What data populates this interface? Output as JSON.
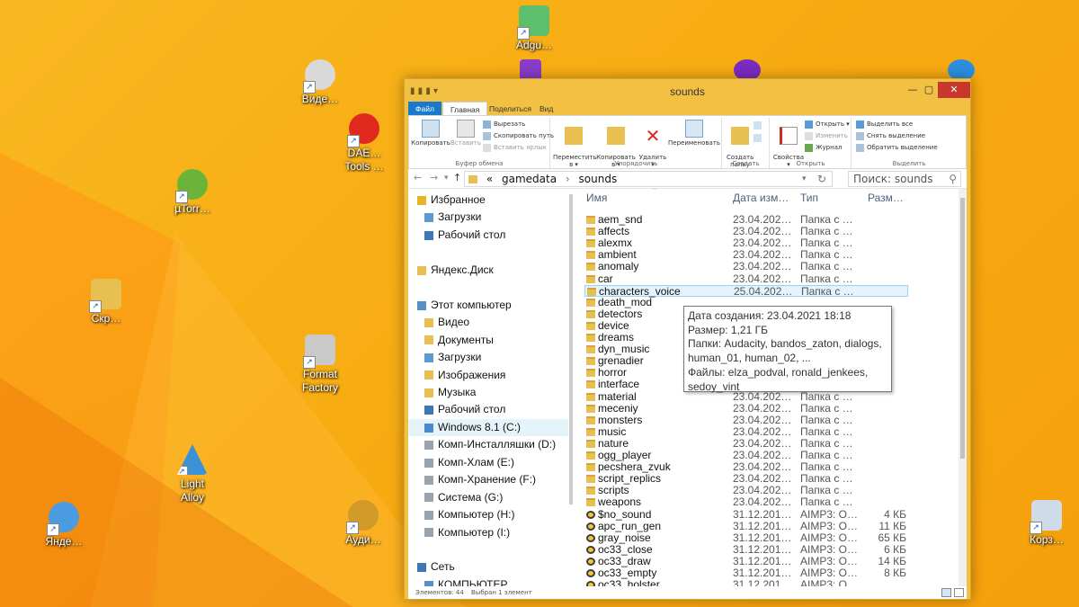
{
  "desktop": {
    "icons": [
      {
        "label": "Adgu…",
        "icon": "adguard-icon",
        "color": "#5bbf6b"
      },
      {
        "label": "Виде…",
        "icon": "video-icon",
        "color": "#d9d9d9"
      },
      {
        "label": "DAE…\nTools …",
        "icon": "daemon-tools-icon",
        "color": "#e02a1f"
      },
      {
        "label": "µTorr…",
        "icon": "utorrent-icon",
        "color": "#6ab43a"
      },
      {
        "label": "Скр…",
        "icon": "folder-icon",
        "color": "#e8c051"
      },
      {
        "label": "Format\nFactory",
        "icon": "format-factory-icon",
        "color": "#c9c9c9"
      },
      {
        "label": "Light\nAlloy",
        "icon": "light-alloy-icon",
        "color": "#3a93d6"
      },
      {
        "label": "Янде…",
        "icon": "yandex-disk-icon",
        "color": "#4a9be0"
      },
      {
        "label": "Ауди…",
        "icon": "audio-icon",
        "color": "#d29a2a"
      },
      {
        "label": "Корз…",
        "icon": "recycle-bin-icon",
        "color": "#cfdbe8"
      }
    ]
  },
  "window": {
    "title": "sounds",
    "tabs": [
      "Файл",
      "Главная",
      "Поделиться",
      "Вид"
    ],
    "ribbon": {
      "clipboard": {
        "copy": "Копировать",
        "paste": "Вставить",
        "cut": "Вырезать",
        "copy_path": "Скопировать путь",
        "paste_shortcut": "Вставить ярлык",
        "group": "Буфер обмена"
      },
      "organize": {
        "move": "Переместить\nв ▾",
        "copy_to": "Копировать\nв ▾",
        "delete": "Удалить\n▾",
        "rename": "Переименовать",
        "group": "Упорядочить"
      },
      "new": {
        "new_folder": "Создать\nпапку",
        "group": "Создать"
      },
      "open": {
        "properties": "Свойства\n▾",
        "open": "Открыть ▾",
        "edit": "Изменить",
        "history": "Журнал",
        "group": "Открыть"
      },
      "select": {
        "select_all": "Выделить все",
        "select_none": "Снять выделение",
        "invert": "Обратить выделение",
        "group": "Выделить"
      }
    },
    "address": {
      "root": "«",
      "crumbs": [
        "gamedata",
        "sounds"
      ],
      "search_placeholder": "Поиск: sounds"
    },
    "nav": [
      {
        "label": "Избранное",
        "icon": "star-icon",
        "indent": 0
      },
      {
        "label": "Загрузки",
        "icon": "downloads-icon",
        "indent": 1
      },
      {
        "label": "Рабочий стол",
        "icon": "desktop-icon",
        "indent": 1
      },
      {
        "label": "",
        "icon": "",
        "indent": 0
      },
      {
        "label": "Яндекс.Диск",
        "icon": "folder-icon",
        "indent": 0
      },
      {
        "label": "",
        "icon": "",
        "indent": 0
      },
      {
        "label": "Этот компьютер",
        "icon": "computer-icon",
        "indent": 0
      },
      {
        "label": "Видео",
        "icon": "video-folder-icon",
        "indent": 1
      },
      {
        "label": "Документы",
        "icon": "documents-icon",
        "indent": 1
      },
      {
        "label": "Загрузки",
        "icon": "downloads-icon",
        "indent": 1
      },
      {
        "label": "Изображения",
        "icon": "pictures-icon",
        "indent": 1
      },
      {
        "label": "Музыка",
        "icon": "music-icon",
        "indent": 1
      },
      {
        "label": "Рабочий стол",
        "icon": "desktop-icon",
        "indent": 1
      },
      {
        "label": "Windows 8.1 (C:)",
        "icon": "drive-c-icon",
        "indent": 1
      },
      {
        "label": "Комп-Инсталляшки (D:)",
        "icon": "drive-icon",
        "indent": 1
      },
      {
        "label": "Комп-Хлам (E:)",
        "icon": "drive-icon",
        "indent": 1
      },
      {
        "label": "Комп-Хранение (F:)",
        "icon": "drive-icon",
        "indent": 1
      },
      {
        "label": "Система (G:)",
        "icon": "drive-icon",
        "indent": 1
      },
      {
        "label": "Компьютер (H:)",
        "icon": "drive-icon",
        "indent": 1
      },
      {
        "label": "Компьютер (I:)",
        "icon": "drive-icon",
        "indent": 1
      },
      {
        "label": "",
        "icon": "",
        "indent": 0
      },
      {
        "label": "Сеть",
        "icon": "network-icon",
        "indent": 0
      },
      {
        "label": "КОМПЬЮТЕР",
        "icon": "computer-icon",
        "indent": 1
      }
    ],
    "columns": {
      "name": "Имя",
      "date": "Дата изм…",
      "type": "Тип",
      "size": "Разм…"
    },
    "files": [
      {
        "name": "aem_snd",
        "date": "23.04.202…",
        "type": "Папка с …",
        "size": "",
        "kind": "folder"
      },
      {
        "name": "affects",
        "date": "23.04.202…",
        "type": "Папка с …",
        "size": "",
        "kind": "folder"
      },
      {
        "name": "alexmx",
        "date": "23.04.202…",
        "type": "Папка с …",
        "size": "",
        "kind": "folder"
      },
      {
        "name": "ambient",
        "date": "23.04.202…",
        "type": "Папка с …",
        "size": "",
        "kind": "folder"
      },
      {
        "name": "anomaly",
        "date": "23.04.202…",
        "type": "Папка с …",
        "size": "",
        "kind": "folder"
      },
      {
        "name": "car",
        "date": "23.04.202…",
        "type": "Папка с …",
        "size": "",
        "kind": "folder"
      },
      {
        "name": "characters_voice",
        "date": "25.04.202…",
        "type": "Папка с …",
        "size": "",
        "kind": "folder",
        "selected": true
      },
      {
        "name": "death_mod",
        "date": "",
        "type": "",
        "size": "",
        "kind": "folder"
      },
      {
        "name": "detectors",
        "date": "",
        "type": "",
        "size": "",
        "kind": "folder"
      },
      {
        "name": "device",
        "date": "",
        "type": "",
        "size": "",
        "kind": "folder"
      },
      {
        "name": "dreams",
        "date": "",
        "type": "",
        "size": "",
        "kind": "folder"
      },
      {
        "name": "dyn_music",
        "date": "",
        "type": "",
        "size": "",
        "kind": "folder"
      },
      {
        "name": "grenadier",
        "date": "",
        "type": "",
        "size": "",
        "kind": "folder"
      },
      {
        "name": "horror",
        "date": "",
        "type": "",
        "size": "",
        "kind": "folder"
      },
      {
        "name": "interface",
        "date": "",
        "type": "",
        "size": "",
        "kind": "folder"
      },
      {
        "name": "material",
        "date": "23.04.202…",
        "type": "Папка с …",
        "size": "",
        "kind": "folder"
      },
      {
        "name": "meceniy",
        "date": "23.04.202…",
        "type": "Папка с …",
        "size": "",
        "kind": "folder"
      },
      {
        "name": "monsters",
        "date": "23.04.202…",
        "type": "Папка с …",
        "size": "",
        "kind": "folder"
      },
      {
        "name": "music",
        "date": "23.04.202…",
        "type": "Папка с …",
        "size": "",
        "kind": "folder"
      },
      {
        "name": "nature",
        "date": "23.04.202…",
        "type": "Папка с …",
        "size": "",
        "kind": "folder"
      },
      {
        "name": "ogg_player",
        "date": "23.04.202…",
        "type": "Папка с …",
        "size": "",
        "kind": "folder"
      },
      {
        "name": "pecshera_zvuk",
        "date": "23.04.202…",
        "type": "Папка с …",
        "size": "",
        "kind": "folder"
      },
      {
        "name": "script_replics",
        "date": "23.04.202…",
        "type": "Папка с …",
        "size": "",
        "kind": "folder"
      },
      {
        "name": "scripts",
        "date": "23.04.202…",
        "type": "Папка с …",
        "size": "",
        "kind": "folder"
      },
      {
        "name": "weapons",
        "date": "23.04.202…",
        "type": "Папка с …",
        "size": "",
        "kind": "folder"
      },
      {
        "name": "$no_sound",
        "date": "31.12.201…",
        "type": "AIMP3: O…",
        "size": "4 КБ",
        "kind": "aimp"
      },
      {
        "name": "apc_run_gen",
        "date": "31.12.201…",
        "type": "AIMP3: O…",
        "size": "11 КБ",
        "kind": "aimp"
      },
      {
        "name": "gray_noise",
        "date": "31.12.201…",
        "type": "AIMP3: O…",
        "size": "65 КБ",
        "kind": "aimp"
      },
      {
        "name": "oc33_close",
        "date": "31.12.201…",
        "type": "AIMP3: O…",
        "size": "6 КБ",
        "kind": "aimp"
      },
      {
        "name": "oc33_draw",
        "date": "31.12.201…",
        "type": "AIMP3: O…",
        "size": "14 КБ",
        "kind": "aimp"
      },
      {
        "name": "oc33_empty",
        "date": "31.12.201…",
        "type": "AIMP3: O…",
        "size": "8 КБ",
        "kind": "aimp"
      },
      {
        "name": "oc33_holster",
        "date": "31.12.201…",
        "type": "AIMP3: O…",
        "size": "",
        "kind": "aimp"
      }
    ],
    "tooltip": [
      "Дата создания: 23.04.2021 18:18",
      "Размер: 1,21 ГБ",
      "Папки: Audacity, bandos_zaton, dialogs,",
      "human_01, human_02, ...",
      "Файлы: elza_podval, ronald_jenkees,",
      "sedoy_vint"
    ],
    "status": {
      "count": "Элементов: 44",
      "selected": "Выбран 1 элемент"
    }
  },
  "colors": {
    "accent": "#1979ca",
    "selection": "#e5f3fb",
    "title_bar": "#f2c144",
    "close": "#c7372b"
  }
}
